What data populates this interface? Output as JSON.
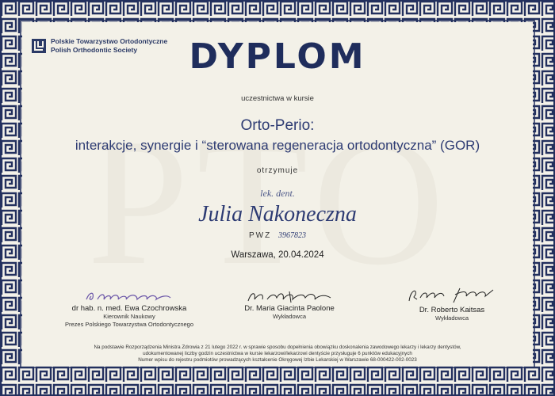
{
  "organization": {
    "name_pl": "Polskie Towarzystwo Ortodontyczne",
    "name_en": "Polish Orthodontic Society",
    "watermark": "PTO"
  },
  "title": "DYPLOM",
  "subtitle": "uczestnictwa w kursie",
  "course": {
    "line1": "Orto-Perio:",
    "line2": "interakcje, synergie i “sterowana regeneracja ortodontyczna” (GOR)"
  },
  "receives_label": "otrzymuje",
  "recipient": {
    "title": "lek. dent.",
    "name": "Julia Nakoneczna",
    "pwz_label": "PWZ",
    "pwz_number": "3967823"
  },
  "place_date": "Warszawa, 20.04.2024",
  "signatories": [
    {
      "name": "dr hab. n. med. Ewa Czochrowska",
      "role1": "Kierownik Naukowy",
      "role2": "Prezes Polskiego Towarzystwa Ortodontycznego"
    },
    {
      "name": "Dr. Maria Giacinta Paolone",
      "role1": "Wykładowca",
      "role2": ""
    },
    {
      "name": "Dr. Roberto Kaitsas",
      "role1": "Wykładowca",
      "role2": ""
    }
  ],
  "footer": {
    "line1": "Na podstawie Rozporządzenia Ministra Zdrowia z 21 lutego 2022 r. w sprawie sposobu dopełnienia obowiązku doskonalenia zawodowego lekarzy i lekarzy dentystów,",
    "line2": "udokumentowanej liczby godzin uczestnictwa w kursie lekarzowi/lekarzowi dentyście przysługuje 6 punktów edukacyjnych",
    "line3": "Numer wpisu do rejestru podmiotów prowadzących kształcenie Okręgowej Izbie Lekarskiej w Warszawie 68-000422-002-0023"
  },
  "colors": {
    "border": "#23305e",
    "accent": "#2d3b73",
    "background": "#f4f2ea"
  }
}
